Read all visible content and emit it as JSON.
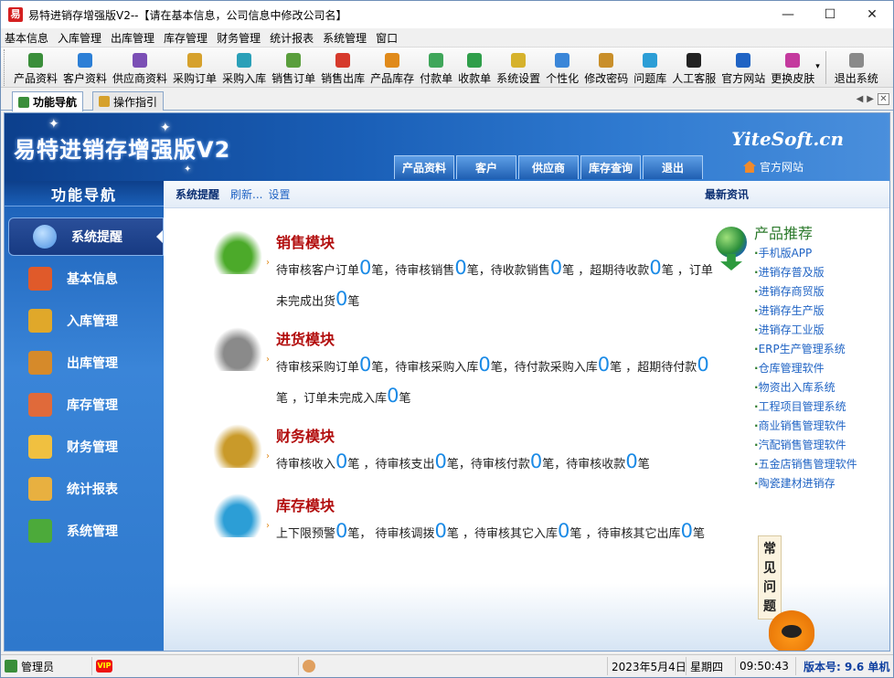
{
  "window": {
    "title": "易特进销存增强版V2--【请在基本信息，公司信息中修改公司名】",
    "app_icon_text": "易",
    "minimize": "—",
    "maximize": "☐",
    "close": "✕"
  },
  "menu": [
    "基本信息",
    "入库管理",
    "出库管理",
    "库存管理",
    "财务管理",
    "统计报表",
    "系统管理",
    "窗口"
  ],
  "toolbar": [
    {
      "label": "产品资料",
      "color": "#3a8e3a"
    },
    {
      "label": "客户资料",
      "color": "#2c7fd6"
    },
    {
      "label": "供应商资料",
      "color": "#7b4fb5"
    },
    {
      "label": "采购订单",
      "color": "#d6a12c"
    },
    {
      "label": "采购入库",
      "color": "#2aa0b8"
    },
    {
      "label": "销售订单",
      "color": "#5a9e3c"
    },
    {
      "label": "销售出库",
      "color": "#d63a2c"
    },
    {
      "label": "产品库存",
      "color": "#e08a1a"
    },
    {
      "label": "付款单",
      "color": "#3fa65a"
    },
    {
      "label": "收款单",
      "color": "#2f9e4a"
    },
    {
      "label": "系统设置",
      "color": "#d6b22c"
    },
    {
      "label": "个性化",
      "color": "#3a86d8"
    },
    {
      "label": "修改密码",
      "color": "#c98f2a"
    },
    {
      "label": "问题库",
      "color": "#2c9ed6"
    },
    {
      "label": "人工客服",
      "color": "#222222"
    },
    {
      "label": "官方网站",
      "color": "#1f63c4"
    },
    {
      "label": "更换皮肤",
      "color": "#c43a9e"
    },
    {
      "label": "退出系统",
      "color": "#8a8a8a"
    }
  ],
  "tabs": [
    {
      "label": "功能导航",
      "active": true
    },
    {
      "label": "操作指引",
      "active": false
    }
  ],
  "banner": {
    "title": "易特进销存增强版V2",
    "logo": "YiteSoft.cn",
    "tabs": [
      "产品资料",
      "客户",
      "供应商",
      "库存查询",
      "退出"
    ],
    "official_site": "官方网站"
  },
  "sidebar": {
    "header": "功能导航",
    "items": [
      {
        "label": "系统提醒",
        "active": true,
        "icon_color": "#4a90e2"
      },
      {
        "label": "基本信息",
        "active": false,
        "icon_color": "#e05a2a"
      },
      {
        "label": "入库管理",
        "active": false,
        "icon_color": "#e0a82a"
      },
      {
        "label": "出库管理",
        "active": false,
        "icon_color": "#d68a2a"
      },
      {
        "label": "库存管理",
        "active": false,
        "icon_color": "#e06a3a"
      },
      {
        "label": "财务管理",
        "active": false,
        "icon_color": "#f0c040"
      },
      {
        "label": "统计报表",
        "active": false,
        "icon_color": "#e8b040"
      },
      {
        "label": "系统管理",
        "active": false,
        "icon_color": "#4caa3a"
      }
    ]
  },
  "subbar": {
    "title": "系统提醒",
    "refresh": "刷新...",
    "settings": "设置",
    "news": "最新资讯"
  },
  "modules": [
    {
      "title": "销售模块",
      "icon_color": "#4caa2a",
      "parts": [
        "待审核客户订单",
        "0",
        "笔，待审核销售",
        "0",
        "笔，待收款销售",
        "0",
        "笔 ，超期待收款",
        "0",
        "笔 ，订单未完成出货",
        "0",
        "笔"
      ]
    },
    {
      "title": "进货模块",
      "icon_color": "#8a8a8a",
      "parts": [
        "待审核采购订单",
        "0",
        "笔，待审核采购入库",
        "0",
        "笔，待付款采购入库",
        "0",
        "笔 ，超期待付款",
        "0",
        "笔 ，订单未完成入库",
        "0",
        "笔"
      ]
    },
    {
      "title": "财务模块",
      "icon_color": "#c99a2a",
      "parts": [
        "待审核收入",
        "0",
        "笔 ，待审核支出",
        "0",
        "笔，待审核付款",
        "0",
        "笔，待审核收款",
        "0",
        "笔"
      ]
    },
    {
      "title": "库存模块",
      "icon_color": "#2c9ed6",
      "parts": [
        "上下限预警",
        "0",
        "笔， 待审核调拨",
        "0",
        "笔 ，待审核其它入库",
        "0",
        "笔 ，待审核其它出库",
        "0",
        "笔"
      ]
    }
  ],
  "products": {
    "title": "产品推荐",
    "items": [
      "手机版APP",
      "进销存普及版",
      "进销存商贸版",
      "进销存生产版",
      "进销存工业版",
      "ERP生产管理系统",
      "仓库管理软件",
      "物资出入库系统",
      "工程项目管理系统",
      "商业销售管理软件",
      "汽配销售管理软件",
      "五金店销售管理软件",
      "陶瓷建材进销存"
    ]
  },
  "faq": "常见问题",
  "status": {
    "user": "管理员",
    "vip": "VIP",
    "date": "2023年5月4日",
    "weekday": "星期四",
    "time": "09:50:43",
    "version": "版本号: 9.6 单机"
  }
}
